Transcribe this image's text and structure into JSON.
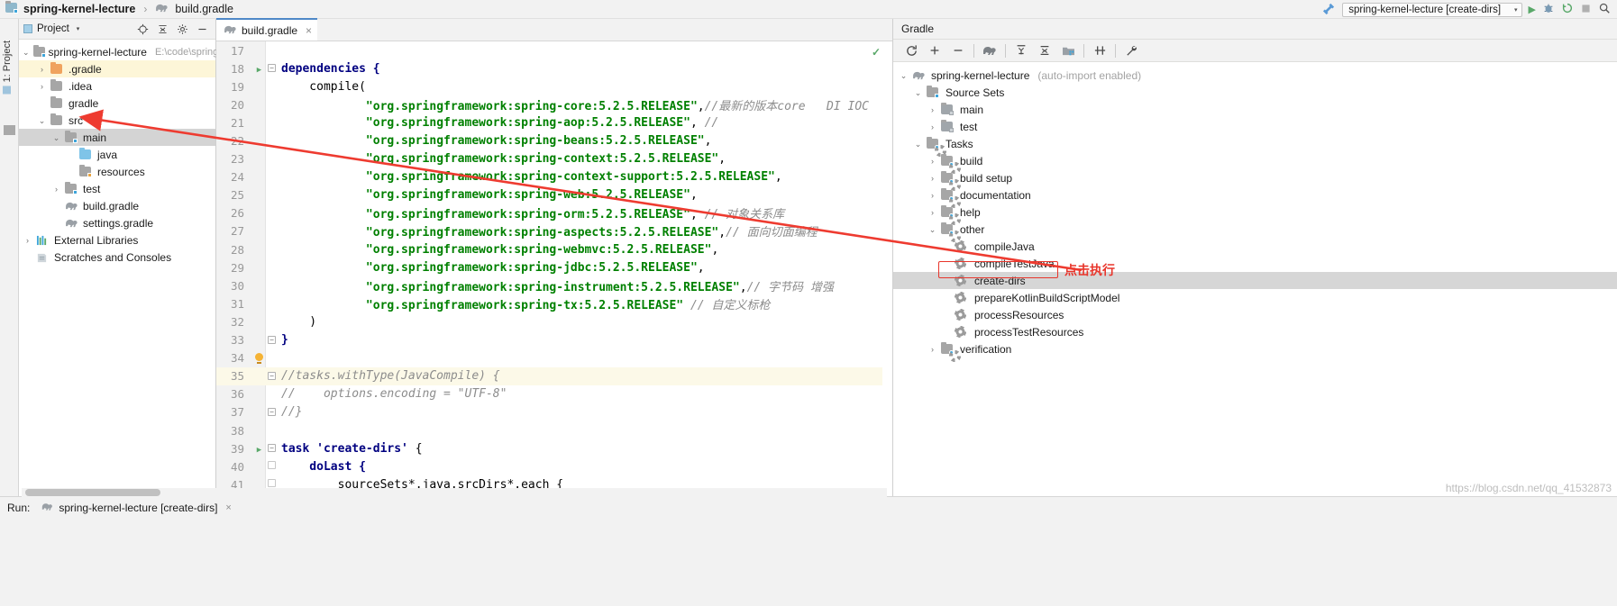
{
  "titlebar": {
    "project_name": "spring-kernel-lecture",
    "separator": "›",
    "file_name": "build.gradle",
    "run_config": "spring-kernel-lecture [create-dirs]",
    "caret": "▾",
    "icons": {
      "hammer": "hammer-icon",
      "run": "▶",
      "debug": "debug-icon",
      "rerun": "↻",
      "stop": "■",
      "search": "⌕"
    }
  },
  "left_strip": {
    "tab_label": "1: Project"
  },
  "project_panel": {
    "title": "Project",
    "caret": "▾",
    "toolbar_icons": [
      "locate-icon",
      "collapse-all-icon",
      "settings-gear-icon",
      "hide-minus-icon"
    ],
    "tree": [
      {
        "label": "spring-kernel-lecture",
        "path": "E:\\code\\spring",
        "indent": 0,
        "arrow": "⌄",
        "icon": "folder-module",
        "state": "normal"
      },
      {
        "label": ".gradle",
        "path": "",
        "indent": 1,
        "arrow": "›",
        "icon": "folder-orange",
        "state": "highlight"
      },
      {
        "label": ".idea",
        "path": "",
        "indent": 1,
        "arrow": "›",
        "icon": "folder-grey",
        "state": "normal"
      },
      {
        "label": "gradle",
        "path": "",
        "indent": 1,
        "arrow": "",
        "icon": "folder-grey",
        "state": "normal"
      },
      {
        "label": "src",
        "path": "",
        "indent": 1,
        "arrow": "⌄",
        "icon": "folder-grey",
        "state": "normal"
      },
      {
        "label": "main",
        "path": "",
        "indent": 2,
        "arrow": "⌄",
        "icon": "folder-module",
        "state": "selected"
      },
      {
        "label": "java",
        "path": "",
        "indent": 3,
        "arrow": "",
        "icon": "folder-blue",
        "state": "normal"
      },
      {
        "label": "resources",
        "path": "",
        "indent": 3,
        "arrow": "",
        "icon": "folder-resources",
        "state": "normal"
      },
      {
        "label": "test",
        "path": "",
        "indent": 2,
        "arrow": "›",
        "icon": "folder-module",
        "state": "normal"
      },
      {
        "label": "build.gradle",
        "path": "",
        "indent": 2,
        "arrow": "",
        "icon": "gradle-file",
        "state": "normal"
      },
      {
        "label": "settings.gradle",
        "path": "",
        "indent": 2,
        "arrow": "",
        "icon": "gradle-file",
        "state": "normal"
      },
      {
        "label": "External Libraries",
        "path": "",
        "indent": 0,
        "arrow": "›",
        "icon": "libraries",
        "state": "normal"
      },
      {
        "label": "Scratches and Consoles",
        "path": "",
        "indent": 0,
        "arrow": "",
        "icon": "scratches",
        "state": "normal"
      }
    ]
  },
  "editor": {
    "tab_label": "build.gradle",
    "tab_close": "×",
    "tab_icon": "gradle-file-icon",
    "status_check": "✓",
    "lines": [
      {
        "num": "17",
        "gutter": "",
        "fold": "",
        "tokens": []
      },
      {
        "num": "18",
        "gutter": "run",
        "fold": "minus",
        "tokens": [
          {
            "t": "dependencies {",
            "c": "kw"
          }
        ]
      },
      {
        "num": "19",
        "gutter": "",
        "fold": "",
        "tokens": [
          {
            "t": "    compile(",
            "c": "plain"
          }
        ]
      },
      {
        "num": "20",
        "gutter": "",
        "fold": "",
        "tokens": [
          {
            "t": "            ",
            "c": "plain"
          },
          {
            "t": "\"org.springframework:spring-core:5.2.5.RELEASE\"",
            "c": "str"
          },
          {
            "t": ",",
            "c": "plain"
          },
          {
            "t": "//最新的版本core   DI IOC",
            "c": "cmt"
          }
        ]
      },
      {
        "num": "21",
        "gutter": "",
        "fold": "",
        "tokens": [
          {
            "t": "            ",
            "c": "plain"
          },
          {
            "t": "\"org.springframework:spring-aop:5.2.5.RELEASE\"",
            "c": "str"
          },
          {
            "t": ", ",
            "c": "plain"
          },
          {
            "t": "//",
            "c": "cmt"
          }
        ]
      },
      {
        "num": "22",
        "gutter": "",
        "fold": "",
        "tokens": [
          {
            "t": "            ",
            "c": "plain"
          },
          {
            "t": "\"org.springframework:spring-beans:5.2.5.RELEASE\"",
            "c": "str"
          },
          {
            "t": ",",
            "c": "plain"
          }
        ]
      },
      {
        "num": "23",
        "gutter": "",
        "fold": "",
        "tokens": [
          {
            "t": "            ",
            "c": "plain"
          },
          {
            "t": "\"org.springframework:spring-context:5.2.5.RELEASE\"",
            "c": "str"
          },
          {
            "t": ",",
            "c": "plain"
          }
        ]
      },
      {
        "num": "24",
        "gutter": "",
        "fold": "",
        "tokens": [
          {
            "t": "            ",
            "c": "plain"
          },
          {
            "t": "\"org.springframework:spring-context-support:5.2.5.RELEASE\"",
            "c": "str"
          },
          {
            "t": ",",
            "c": "plain"
          }
        ]
      },
      {
        "num": "25",
        "gutter": "",
        "fold": "",
        "tokens": [
          {
            "t": "            ",
            "c": "plain"
          },
          {
            "t": "\"org.springframework:spring-web:5.2.5.RELEASE\"",
            "c": "str"
          },
          {
            "t": ",",
            "c": "plain"
          }
        ]
      },
      {
        "num": "26",
        "gutter": "",
        "fold": "",
        "tokens": [
          {
            "t": "            ",
            "c": "plain"
          },
          {
            "t": "\"org.springframework:spring-orm:5.2.5.RELEASE\"",
            "c": "str"
          },
          {
            "t": ", ",
            "c": "plain"
          },
          {
            "t": "// 对象关系库",
            "c": "cmt"
          }
        ]
      },
      {
        "num": "27",
        "gutter": "",
        "fold": "",
        "tokens": [
          {
            "t": "            ",
            "c": "plain"
          },
          {
            "t": "\"org.springframework:spring-aspects:5.2.5.RELEASE\"",
            "c": "str"
          },
          {
            "t": ",",
            "c": "plain"
          },
          {
            "t": "// 面向切面编程",
            "c": "cmt"
          }
        ]
      },
      {
        "num": "28",
        "gutter": "",
        "fold": "",
        "tokens": [
          {
            "t": "            ",
            "c": "plain"
          },
          {
            "t": "\"org.springframework:spring-webmvc:5.2.5.RELEASE\"",
            "c": "str"
          },
          {
            "t": ",",
            "c": "plain"
          }
        ]
      },
      {
        "num": "29",
        "gutter": "",
        "fold": "",
        "tokens": [
          {
            "t": "            ",
            "c": "plain"
          },
          {
            "t": "\"org.springframework:spring-jdbc:5.2.5.RELEASE\"",
            "c": "str"
          },
          {
            "t": ",",
            "c": "plain"
          }
        ]
      },
      {
        "num": "30",
        "gutter": "",
        "fold": "",
        "tokens": [
          {
            "t": "            ",
            "c": "plain"
          },
          {
            "t": "\"org.springframework:spring-instrument:5.2.5.RELEASE\"",
            "c": "str"
          },
          {
            "t": ",",
            "c": "plain"
          },
          {
            "t": "// 字节码 增强",
            "c": "cmt"
          }
        ]
      },
      {
        "num": "31",
        "gutter": "",
        "fold": "",
        "tokens": [
          {
            "t": "            ",
            "c": "plain"
          },
          {
            "t": "\"org.springframework:spring-tx:5.2.5.RELEASE\"",
            "c": "str"
          },
          {
            "t": " ",
            "c": "plain"
          },
          {
            "t": "// 自定义标枪",
            "c": "cmt"
          }
        ]
      },
      {
        "num": "32",
        "gutter": "",
        "fold": "",
        "tokens": [
          {
            "t": "    )",
            "c": "plain"
          }
        ]
      },
      {
        "num": "33",
        "gutter": "",
        "fold": "minus",
        "tokens": [
          {
            "t": "}",
            "c": "kw"
          }
        ]
      },
      {
        "num": "34",
        "gutter": "bulb",
        "fold": "",
        "tokens": []
      },
      {
        "num": "35",
        "gutter": "",
        "fold": "minus",
        "hl": true,
        "tokens": [
          {
            "t": "//tasks.withType(JavaCompile) {",
            "c": "cmt"
          }
        ]
      },
      {
        "num": "36",
        "gutter": "",
        "fold": "",
        "tokens": [
          {
            "t": "//    options.encoding = \"UTF-8\"",
            "c": "cmt"
          }
        ]
      },
      {
        "num": "37",
        "gutter": "",
        "fold": "minus",
        "tokens": [
          {
            "t": "//}",
            "c": "cmt"
          }
        ]
      },
      {
        "num": "38",
        "gutter": "",
        "fold": "",
        "tokens": []
      },
      {
        "num": "39",
        "gutter": "run",
        "fold": "minus",
        "tokens": [
          {
            "t": "task ",
            "c": "kw"
          },
          {
            "t": "'create-dirs'",
            "c": "kw"
          },
          {
            "t": " {",
            "c": "plain"
          }
        ]
      },
      {
        "num": "40",
        "gutter": "",
        "fold": "minus2",
        "tokens": [
          {
            "t": "    doLast {",
            "c": "kw"
          }
        ]
      },
      {
        "num": "41",
        "gutter": "",
        "fold": "minus2",
        "tokens": [
          {
            "t": "        sourceSets*.java.srcDirs*.each {",
            "c": "plain"
          }
        ]
      }
    ]
  },
  "gradle_panel": {
    "title": "Gradle",
    "toolbar_icons": [
      "refresh-icon",
      "add-icon",
      "remove-icon",
      "gradle-elephant-icon",
      "expand-all-icon",
      "collapse-all-icon",
      "module-icon",
      "toggle-offline-icon",
      "settings-wrench-icon"
    ],
    "tree": [
      {
        "label": "spring-kernel-lecture",
        "suffix": "(auto-import enabled)",
        "indent": 0,
        "arrow": "⌄",
        "icon": "gradle-elephant",
        "state": "normal"
      },
      {
        "label": "Source Sets",
        "suffix": "",
        "indent": 1,
        "arrow": "⌄",
        "icon": "folder-sourcesets",
        "state": "normal"
      },
      {
        "label": "main",
        "suffix": "",
        "indent": 2,
        "arrow": "›",
        "icon": "folder-module-grey",
        "state": "normal"
      },
      {
        "label": "test",
        "suffix": "",
        "indent": 2,
        "arrow": "›",
        "icon": "folder-module-grey",
        "state": "normal"
      },
      {
        "label": "Tasks",
        "suffix": "",
        "indent": 1,
        "arrow": "⌄",
        "icon": "folder-tasks",
        "state": "normal"
      },
      {
        "label": "build",
        "suffix": "",
        "indent": 2,
        "arrow": "›",
        "icon": "folder-tasks",
        "state": "normal"
      },
      {
        "label": "build setup",
        "suffix": "",
        "indent": 2,
        "arrow": "›",
        "icon": "folder-tasks",
        "state": "normal"
      },
      {
        "label": "documentation",
        "suffix": "",
        "indent": 2,
        "arrow": "›",
        "icon": "folder-tasks",
        "state": "normal"
      },
      {
        "label": "help",
        "suffix": "",
        "indent": 2,
        "arrow": "›",
        "icon": "folder-tasks",
        "state": "normal"
      },
      {
        "label": "other",
        "suffix": "",
        "indent": 2,
        "arrow": "⌄",
        "icon": "folder-tasks",
        "state": "normal"
      },
      {
        "label": "compileJava",
        "suffix": "",
        "indent": 3,
        "arrow": "",
        "icon": "task-gear",
        "state": "normal"
      },
      {
        "label": "compileTestJava",
        "suffix": "",
        "indent": 3,
        "arrow": "",
        "icon": "task-gear",
        "state": "normal"
      },
      {
        "label": "create-dirs",
        "suffix": "",
        "indent": 3,
        "arrow": "",
        "icon": "task-gear",
        "state": "selected"
      },
      {
        "label": "prepareKotlinBuildScriptModel",
        "suffix": "",
        "indent": 3,
        "arrow": "",
        "icon": "task-gear",
        "state": "normal"
      },
      {
        "label": "processResources",
        "suffix": "",
        "indent": 3,
        "arrow": "",
        "icon": "task-gear",
        "state": "normal"
      },
      {
        "label": "processTestResources",
        "suffix": "",
        "indent": 3,
        "arrow": "",
        "icon": "task-gear",
        "state": "normal"
      },
      {
        "label": "verification",
        "suffix": "",
        "indent": 2,
        "arrow": "›",
        "icon": "folder-tasks",
        "state": "normal"
      }
    ]
  },
  "annotations": {
    "click_to_run_label": "点击执行",
    "highlight_color": "#e8352b",
    "arrow_color": "#ee3b30"
  },
  "bottom_bar": {
    "run_label": "Run:",
    "run_tab_label": "spring-kernel-lecture [create-dirs]",
    "run_tab_close": "×",
    "watermark": "https://blog.csdn.net/qq_41532873"
  }
}
